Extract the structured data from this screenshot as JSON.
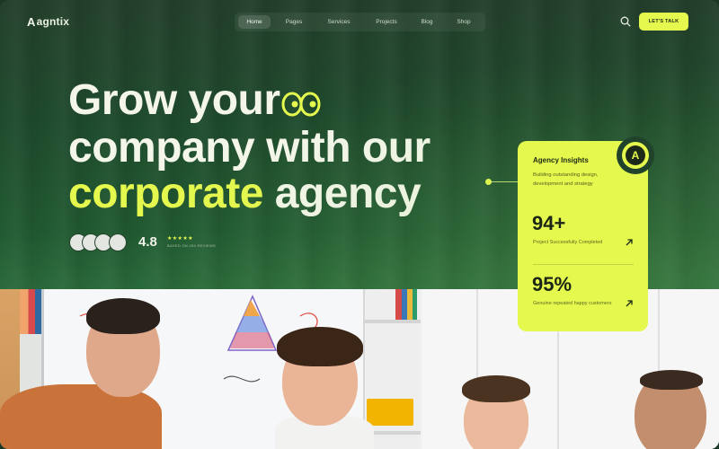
{
  "brand": {
    "name": "agntix",
    "mark": "A"
  },
  "nav": {
    "items": [
      {
        "label": "Home",
        "active": true
      },
      {
        "label": "Pages",
        "active": false
      },
      {
        "label": "Services",
        "active": false
      },
      {
        "label": "Projects",
        "active": false
      },
      {
        "label": "Blog",
        "active": false
      },
      {
        "label": "Shop",
        "active": false
      }
    ],
    "search_icon": "search-icon",
    "cta_label": "LET'S TALK"
  },
  "hero": {
    "line1": "Grow your",
    "line2": "company with our",
    "line3_accent": "corporate",
    "line3_rest": "agency",
    "rating_value": "4.8",
    "stars": "★★★★★",
    "rating_caption": "BASED ON 259 REVIEWS"
  },
  "insights": {
    "title": "Agency Insights",
    "description": "Building outstanding design, development and strategy",
    "badge": "A",
    "stats": [
      {
        "value": "94+",
        "label": "Project Successfully Completed"
      },
      {
        "value": "95%",
        "label": "Genuine repeated happy customers"
      }
    ]
  },
  "colors": {
    "accent": "#e5f84e",
    "hero_bg": "#1f4a2c",
    "text_light": "#f4f6ea"
  }
}
